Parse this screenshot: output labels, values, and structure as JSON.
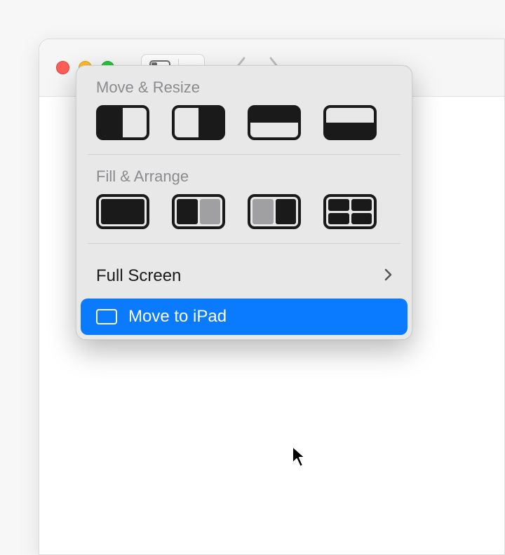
{
  "menu": {
    "section1_label": "Move & Resize",
    "section2_label": "Fill & Arrange",
    "full_screen_label": "Full Screen",
    "move_to_ipad_label": "Move to iPad"
  },
  "colors": {
    "highlight": "#0a7bff"
  }
}
